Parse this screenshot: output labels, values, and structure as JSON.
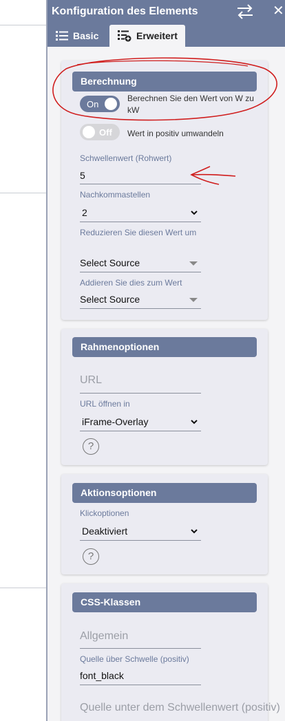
{
  "panel": {
    "title": "Konfiguration des Elements",
    "swap_icon": "swap-arrows-icon",
    "close_icon": "close-icon",
    "close_glyph": "✕"
  },
  "tabs": [
    {
      "label": "Basic",
      "icon": "list-icon"
    },
    {
      "label": "Erweitert",
      "icon": "list-add-icon"
    }
  ],
  "berechnung": {
    "header": "Berechnung",
    "toggle1": {
      "state": "On",
      "label": "Berechnen Sie den Wert von W zu kW"
    },
    "toggle2": {
      "state": "Off",
      "label": "Wert in positiv umwandeln"
    },
    "threshold": {
      "label": "Schwellenwert (Rohwert)",
      "value": "5"
    },
    "decimals": {
      "label": "Nachkommastellen",
      "value": "2"
    },
    "reduce": {
      "label": "Reduzieren Sie diesen Wert um",
      "value": "Select Source"
    },
    "add": {
      "label": "Addieren Sie dies zum Wert",
      "value": "Select Source"
    }
  },
  "rahmen": {
    "header": "Rahmenoptionen",
    "url_placeholder": "URL",
    "open_in": {
      "label": "URL öffnen in",
      "value": "iFrame-Overlay"
    },
    "help_glyph": "?"
  },
  "aktion": {
    "header": "Aktionsoptionen",
    "click": {
      "label": "Klickoptionen",
      "value": "Deaktiviert"
    },
    "help_glyph": "?"
  },
  "css": {
    "header": "CSS-Klassen",
    "general_placeholder": "Allgemein",
    "above": {
      "label": "Quelle über Schwelle (positiv)",
      "value": "font_black"
    },
    "below_placeholder": "Quelle unter dem Schwellenwert (positiv)"
  },
  "colors": {
    "accent": "#6b7a9c",
    "annotation": "#d01e1e"
  }
}
